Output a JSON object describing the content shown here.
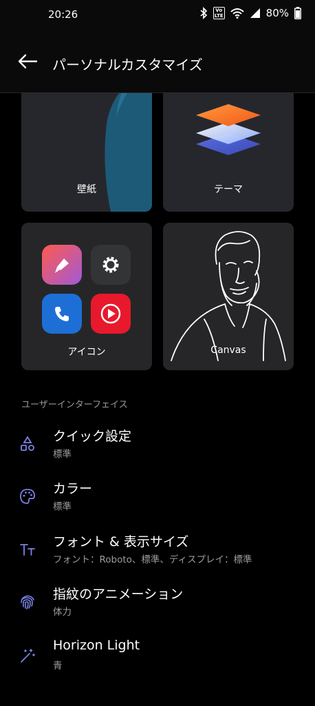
{
  "status_bar": {
    "time": "20:26",
    "volte": "Vo LTE",
    "battery": "80%"
  },
  "header": {
    "title": "パーソナルカスタマイズ"
  },
  "cards": {
    "wallpaper": "壁紙",
    "theme": "テーマ",
    "icons": "アイコン",
    "canvas": "Canvas"
  },
  "section": {
    "title": "ユーザーインターフェイス"
  },
  "items": [
    {
      "title": "クイック設定",
      "subtitle": "標準",
      "icon": "shapes-icon"
    },
    {
      "title": "カラー",
      "subtitle": "標準",
      "icon": "palette-icon"
    },
    {
      "title": "フォント & 表示サイズ",
      "subtitle": "フォント：Roboto、標準、ディスプレイ：標準",
      "icon": "font-size-icon"
    },
    {
      "title": "指紋のアニメーション",
      "subtitle": "体力",
      "icon": "fingerprint-icon"
    },
    {
      "title": "Horizon Light",
      "subtitle": "青",
      "icon": "magic-wand-icon"
    }
  ],
  "colors": {
    "accent": "#7b83e6",
    "background": "#000000",
    "card": "#262628"
  }
}
